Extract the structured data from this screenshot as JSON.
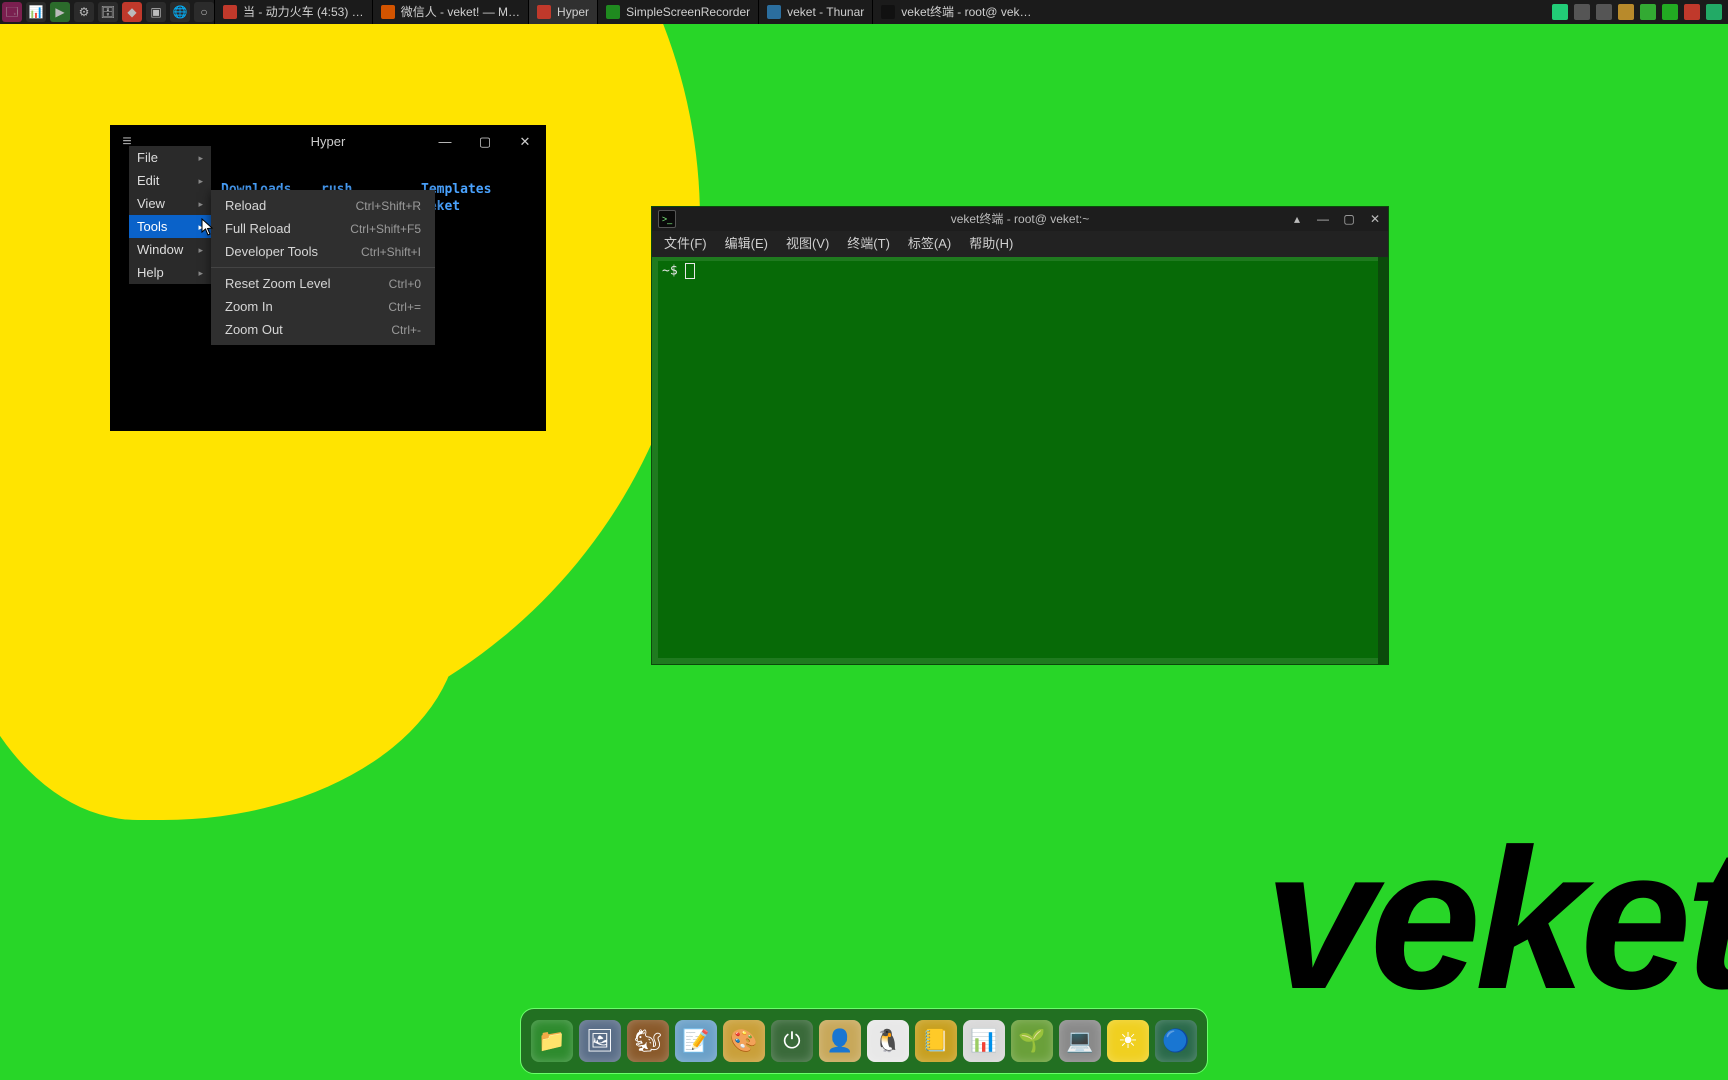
{
  "panel": {
    "launchers": [
      {
        "name": "app-menu-icon",
        "glyph": "🗔",
        "bg": "#7a1f4f"
      },
      {
        "name": "monitor-icon",
        "glyph": "📊",
        "bg": "#2b2b2b"
      },
      {
        "name": "player-icon",
        "glyph": "▶",
        "bg": "#2b6b2b"
      },
      {
        "name": "gear-icon",
        "glyph": "⚙",
        "bg": "#2b2b2b"
      },
      {
        "name": "files-icon",
        "glyph": "🗄",
        "bg": "#2b2b2b"
      },
      {
        "name": "ruby-icon",
        "glyph": "◆",
        "bg": "#c0392b"
      },
      {
        "name": "wemeet-icon",
        "glyph": "▣",
        "bg": "#2b2b2b"
      },
      {
        "name": "browser-icon",
        "glyph": "🌐",
        "bg": "#2b2b2b"
      },
      {
        "name": "dot-icon",
        "glyph": "○",
        "bg": "#2b2b2b"
      }
    ],
    "tasks": [
      {
        "label": "当 - 动力火车 (4:53) …",
        "icon": "#c0392b",
        "name": "task-music"
      },
      {
        "label": "微信人 - veket! — M…",
        "icon": "#d35400",
        "name": "task-browser"
      },
      {
        "label": "Hyper",
        "icon": "#c0392b",
        "name": "task-hyper",
        "active": true
      },
      {
        "label": "SimpleScreenRecorder",
        "icon": "#1f8a1f",
        "name": "task-ssr"
      },
      {
        "label": "veket - Thunar",
        "icon": "#2b6e9e",
        "name": "task-thunar"
      },
      {
        "label": "veket终端 - root@ vek…",
        "icon": "#111",
        "name": "task-terminal"
      }
    ],
    "tray": [
      {
        "name": "keyboard-icon",
        "bg": "#2c7"
      },
      {
        "name": "window-switch-icon",
        "bg": "#555"
      },
      {
        "name": "desktops-icon",
        "bg": "#555"
      },
      {
        "name": "clipboard-icon",
        "bg": "#b88a2b"
      },
      {
        "name": "status-icon",
        "bg": "#3a3"
      },
      {
        "name": "cpu-icon",
        "bg": "#2a2"
      },
      {
        "name": "record-icon",
        "bg": "#c0392b"
      },
      {
        "name": "grid-icon",
        "bg": "#2a6"
      }
    ]
  },
  "hyper": {
    "title": "Hyper",
    "body_words": [
      "Downloads",
      "rush",
      "Templates",
      "veket"
    ],
    "menu": [
      {
        "label": "File",
        "name": "menu-file"
      },
      {
        "label": "Edit",
        "name": "menu-edit"
      },
      {
        "label": "View",
        "name": "menu-view"
      },
      {
        "label": "Tools",
        "name": "menu-tools",
        "selected": true
      },
      {
        "label": "Window",
        "name": "menu-window"
      },
      {
        "label": "Help",
        "name": "menu-help"
      }
    ],
    "submenu": [
      {
        "label": "Reload",
        "shortcut": "Ctrl+Shift+R",
        "name": "tools-reload"
      },
      {
        "label": "Full Reload",
        "shortcut": "Ctrl+Shift+F5",
        "name": "tools-full-reload"
      },
      {
        "label": "Developer Tools",
        "shortcut": "Ctrl+Shift+I",
        "name": "tools-devtools"
      },
      {
        "sep": true
      },
      {
        "label": "Reset Zoom Level",
        "shortcut": "Ctrl+0",
        "name": "tools-reset-zoom"
      },
      {
        "label": "Zoom In",
        "shortcut": "Ctrl+=",
        "name": "tools-zoom-in"
      },
      {
        "label": "Zoom Out",
        "shortcut": "Ctrl+-",
        "name": "tools-zoom-out"
      }
    ],
    "controls": {
      "min": "—",
      "max": "▢",
      "close": "✕"
    }
  },
  "vterm": {
    "title": "veket终端 - root@ veket:~",
    "menubar": [
      {
        "label": "文件(F)",
        "name": "vmenu-file"
      },
      {
        "label": "编辑(E)",
        "name": "vmenu-edit"
      },
      {
        "label": "视图(V)",
        "name": "vmenu-view"
      },
      {
        "label": "终端(T)",
        "name": "vmenu-terminal"
      },
      {
        "label": "标签(A)",
        "name": "vmenu-tabs"
      },
      {
        "label": "帮助(H)",
        "name": "vmenu-help"
      }
    ],
    "prompt": "~$ ",
    "controls": {
      "up": "▴",
      "min": "—",
      "max": "▢",
      "close": "✕"
    }
  },
  "brand": "veket",
  "dock": [
    {
      "name": "dock-files",
      "glyph": "📁",
      "bg": "#2e8b2e"
    },
    {
      "name": "dock-mypaint",
      "glyph": "🖼",
      "bg": "#5a6e88"
    },
    {
      "name": "dock-squirrel",
      "glyph": "🐿",
      "bg": "#8a5a2b"
    },
    {
      "name": "dock-notes",
      "glyph": "📝",
      "bg": "#6aa0c8"
    },
    {
      "name": "dock-palette",
      "glyph": "🎨",
      "bg": "#caa03a"
    },
    {
      "name": "dock-power",
      "glyph": "⏻",
      "bg": "#3a6a3a"
    },
    {
      "name": "dock-user",
      "glyph": "👤",
      "bg": "#c8a85a"
    },
    {
      "name": "dock-tux",
      "glyph": "🐧",
      "bg": "#e8e8e8"
    },
    {
      "name": "dock-dictionary",
      "glyph": "📒",
      "bg": "#c8a020"
    },
    {
      "name": "dock-gnumeric",
      "glyph": "📊",
      "bg": "#d8d8d8"
    },
    {
      "name": "dock-seed",
      "glyph": "🌱",
      "bg": "#6aa03a"
    },
    {
      "name": "dock-laptop",
      "glyph": "💻",
      "bg": "#8a8a8a"
    },
    {
      "name": "dock-sun",
      "glyph": "☀",
      "bg": "#f0d020"
    },
    {
      "name": "dock-sphere",
      "glyph": "🔵",
      "bg": "#2a6a4a"
    }
  ]
}
